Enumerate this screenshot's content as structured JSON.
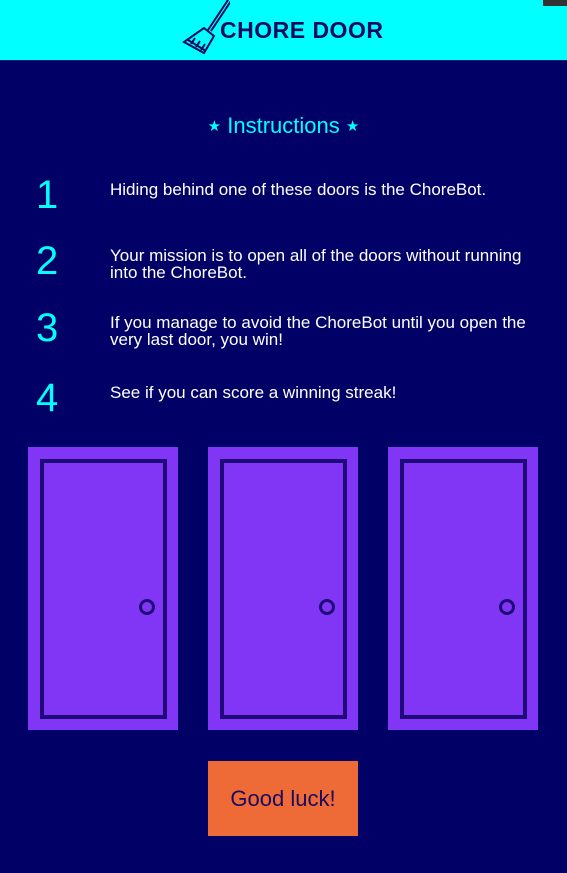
{
  "header": {
    "title": "CHORE DOOR",
    "logo_icon": "broom-icon",
    "background": "#00ffff"
  },
  "instructions": {
    "title": "Instructions",
    "star": "★",
    "steps": [
      {
        "number": "1",
        "text": "Hiding behind one of these doors is the ChoreBot."
      },
      {
        "number": "2",
        "text": "Your mission is to open all of the doors without running into the ChoreBot."
      },
      {
        "number": "3",
        "text": "If you manage to avoid the ChoreBot until you open the very last door, you win!"
      },
      {
        "number": "4",
        "text": "See if you can score a winning streak!"
      }
    ]
  },
  "doors": {
    "count": 3,
    "color": "#8236f5",
    "frame_color": "#1e0a78"
  },
  "start_button": {
    "label": "Good luck!",
    "color": "#ee6b37"
  },
  "colors": {
    "background": "#000066",
    "accent": "#00ffff"
  }
}
